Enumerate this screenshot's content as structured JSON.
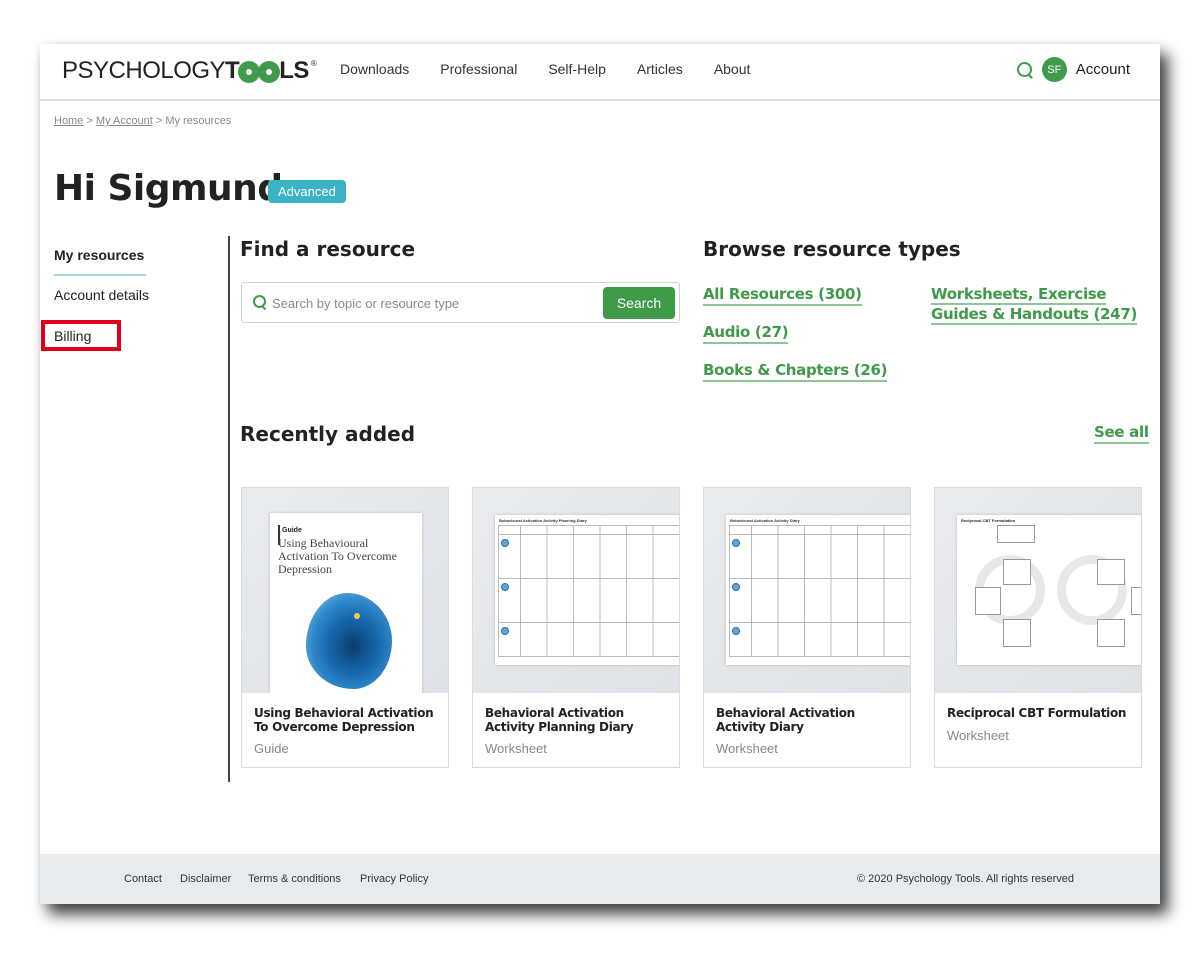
{
  "header": {
    "logo_left": "PSYCHOLOGY",
    "logo_t": "T",
    "logo_right": "LS",
    "logo_reg": "®",
    "nav": [
      "Downloads",
      "Professional",
      "Self-Help",
      "Articles",
      "About"
    ],
    "avatar_initials": "SF",
    "account_label": "Account"
  },
  "breadcrumb": {
    "home": "Home",
    "sep": ">",
    "my_account": "My Account",
    "current": "My resources"
  },
  "page": {
    "title": "Hi Sigmund",
    "badge": "Advanced"
  },
  "sidebar": {
    "items": [
      {
        "label": "My resources",
        "active": true
      },
      {
        "label": "Account details",
        "active": false
      },
      {
        "label": "Billing",
        "active": false,
        "highlighted": true
      }
    ]
  },
  "find": {
    "heading": "Find a resource",
    "placeholder": "Search by topic or resource type",
    "value": "",
    "button": "Search"
  },
  "browse": {
    "heading": "Browse resource types",
    "links": [
      "All Resources (300)",
      "Audio (27)",
      "Books & Chapters (26)",
      "Worksheets, Exercise Guides & Handouts (247)"
    ]
  },
  "recent": {
    "heading": "Recently added",
    "see_all": "See all",
    "cards": [
      {
        "title": "Using Behavioral Activation To Overcome Depression",
        "type": "Guide",
        "thumb_kicker": "Guide",
        "thumb_title": "Using Behavioural Activation To Overcome Depression"
      },
      {
        "title": "Behavioral Activation Activity Planning Diary",
        "type": "Worksheet"
      },
      {
        "title": "Behavioral Activation Activity Diary",
        "type": "Worksheet"
      },
      {
        "title": "Reciprocal CBT Formulation",
        "type": "Worksheet"
      }
    ]
  },
  "footer": {
    "links": [
      "Contact",
      "Disclaimer",
      "Terms & conditions",
      "Privacy Policy"
    ],
    "copyright": "© 2020 Psychology Tools. All rights reserved"
  },
  "colors": {
    "brand_green": "#3f9a4a",
    "badge_teal": "#3ab4c4",
    "highlight_red": "#e0001b",
    "footer_bg": "#e8ebee"
  }
}
